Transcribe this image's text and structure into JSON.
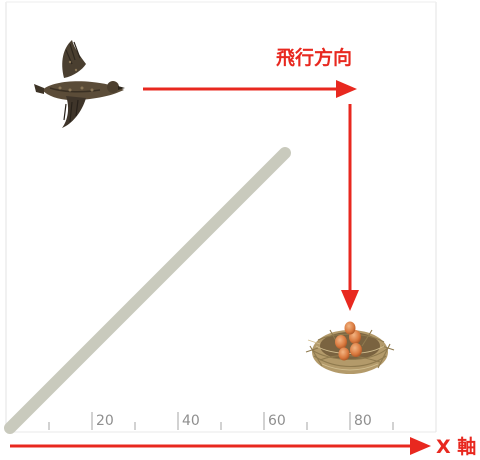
{
  "diagram": {
    "direction_label": "飛行方向",
    "x_axis_label": "X 軸",
    "ticks": [
      "20",
      "40",
      "60",
      "80"
    ],
    "colors": {
      "arrow_red": "#e8281f",
      "label_red": "#e8281f",
      "frame_gray": "#e3e3e3",
      "tick_gray": "#9a9a9a",
      "diagonal_stroke": "#c9cabd"
    },
    "icons": {
      "bird": "flying-bird-icon",
      "nest": "nest-with-eggs-icon"
    }
  }
}
